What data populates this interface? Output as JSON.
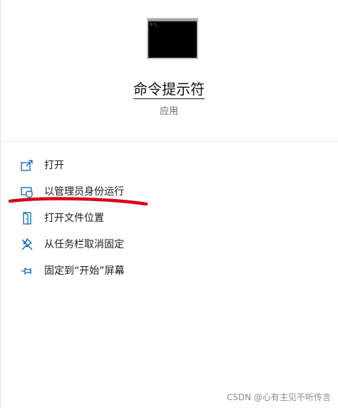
{
  "app": {
    "title": "命令提示符",
    "subtitle": "应用",
    "icon_caption": "C:\\_"
  },
  "menu": {
    "items": [
      {
        "label": "打开",
        "icon": "open-icon"
      },
      {
        "label": "以管理员身份运行",
        "icon": "admin-shield-icon"
      },
      {
        "label": "打开文件位置",
        "icon": "file-location-icon"
      },
      {
        "label": "从任务栏取消固定",
        "icon": "unpin-icon"
      },
      {
        "label": "固定到“开始”屏幕",
        "icon": "pin-icon"
      }
    ]
  },
  "watermark": "CSDN @心有主见不听传言",
  "colors": {
    "accent": "#0a64b4",
    "annotation": "#d8001c"
  }
}
